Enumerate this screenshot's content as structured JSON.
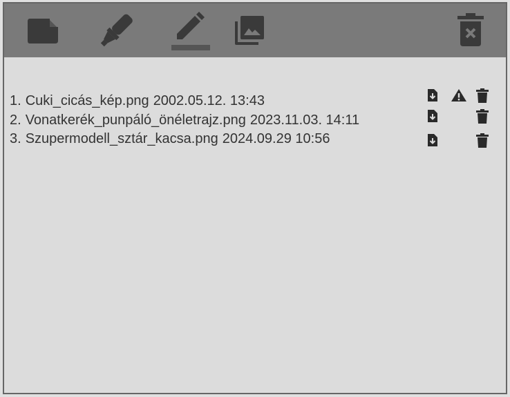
{
  "toolbar": {
    "icons": [
      "new-document-icon",
      "highlighter-icon",
      "pen-icon",
      "gallery-icon",
      "delete-all-icon"
    ]
  },
  "files": [
    {
      "index": "1.",
      "name": "Cuki_cicás_kép.png",
      "date": "2002.05.12. 13:43",
      "warning": true
    },
    {
      "index": "2.",
      "name": "Vonatkerék_punpáló_önéletrajz.png",
      "date": "2023.11.03. 14:11",
      "warning": false
    },
    {
      "index": "3.",
      "name": "Szupermodell_sztár_kacsa.png",
      "date": "2024.09.29 10:56",
      "warning": false
    }
  ],
  "colors": {
    "toolbar_bg": "#7a7a7a",
    "toolbar_icon": "#3a3a3a",
    "content_bg": "#dcdcdc",
    "text": "#333333",
    "action_icon": "#2a2a2a"
  }
}
